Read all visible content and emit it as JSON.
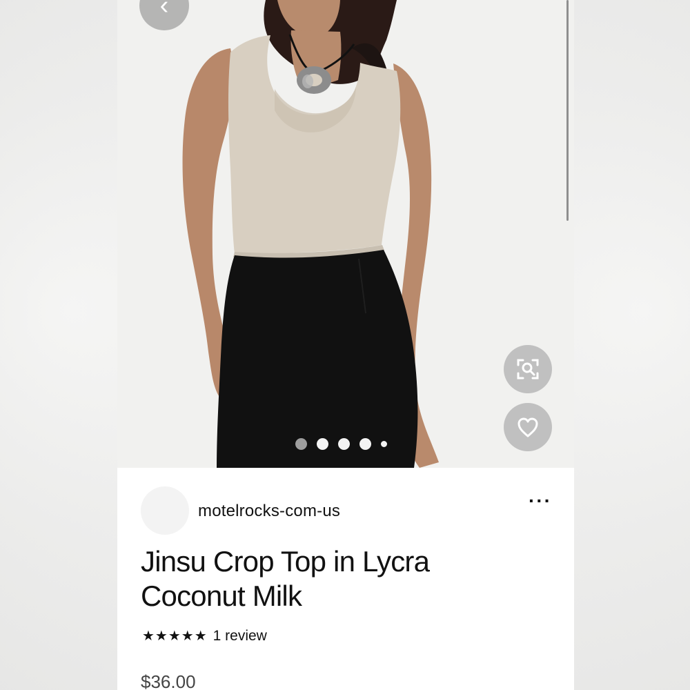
{
  "seller": {
    "name": "motelrocks-com-us"
  },
  "product": {
    "title_line1": "Jinsu Crop Top in Lycra",
    "title_line2": "Coconut Milk",
    "rating_stars": "★★★★★",
    "rating_value": 5,
    "review_text": "1 review",
    "price": "$36.00"
  },
  "gallery": {
    "image_index": 1,
    "image_count": 5
  },
  "icons": {
    "back": "chevron-left-icon",
    "zoom": "zoom-icon",
    "favorite": "heart-icon",
    "more": "more-horizontal-icon"
  },
  "colors": {
    "text": "#111111",
    "top": "#d8cfc1",
    "skirt": "#111111",
    "button_bg": "#b4b4b4"
  }
}
